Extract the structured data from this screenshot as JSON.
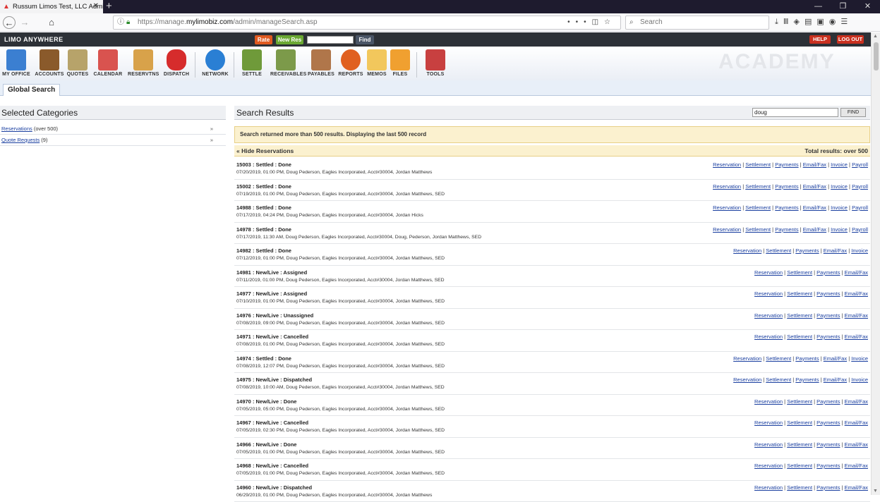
{
  "browser": {
    "tab_title": "Russum Limos Test, LLC Admin",
    "url_domain_prefix": "https://manage.",
    "url_domain": "mylimobiz.com",
    "url_path": "/admin/manageSearch.asp",
    "search_placeholder": "Search"
  },
  "app": {
    "logo": "LIMO ANYWHERE",
    "quick": {
      "rate": "Rate",
      "new_res": "New Res",
      "find": "Find"
    },
    "help": "HELP",
    "logout": "LOG OUT",
    "watermark": "ACADEMY",
    "toolbar": [
      {
        "label": "MY OFFICE",
        "icon": "office-building-icon",
        "color": "#3b7fd1"
      },
      {
        "label": "ACCOUNTS",
        "icon": "address-book-icon",
        "color": "#8a5a2b"
      },
      {
        "label": "QUOTES",
        "icon": "money-bag-icon",
        "color": "#b7a36a"
      },
      {
        "label": "CALENDAR",
        "icon": "calendar-icon",
        "color": "#d9534f"
      },
      {
        "label": "RESERVTNS",
        "icon": "clipboard-icon",
        "color": "#d8a24a"
      },
      {
        "label": "DISPATCH",
        "icon": "car-icon",
        "color": "#d62c2c"
      },
      {
        "label": "NETWORK",
        "icon": "globe-icon",
        "color": "#2a7fd4"
      },
      {
        "label": "SETTLE",
        "icon": "cash-icon",
        "color": "#6f9a3a"
      },
      {
        "label": "RECEIVABLES",
        "icon": "inbox-in-icon",
        "color": "#7c9a4a"
      },
      {
        "label": "PAYABLES",
        "icon": "inbox-out-icon",
        "color": "#b0764a"
      },
      {
        "label": "REPORTS",
        "icon": "pie-chart-icon",
        "color": "#e06020"
      },
      {
        "label": "MEMOS",
        "icon": "sticky-note-icon",
        "color": "#f2c75c"
      },
      {
        "label": "FILES",
        "icon": "folder-icon",
        "color": "#f0a030"
      },
      {
        "label": "TOOLS",
        "icon": "tools-icon",
        "color": "#c84040"
      }
    ],
    "subtab": "Global Search"
  },
  "left": {
    "title": "Selected Categories",
    "items": [
      {
        "label": "Reservations",
        "count": "(over 500)",
        "arrow": "»"
      },
      {
        "label": "Quote Requests",
        "count": "(9)",
        "arrow": "»"
      }
    ]
  },
  "main": {
    "title": "Search Results",
    "search_value": "doug",
    "find_label": "FIND",
    "warning": "Search returned more than 500 results. Displaying the last 500 record",
    "section_toggle": "« Hide Reservations",
    "total": "Total results: over 500",
    "rows": [
      {
        "title": "15003 : Settled : Done",
        "detail": "07/20/2019, 01:00 PM, Doug Pederson, Eagles Incorporated, Acct#30004, Jordan Matthews",
        "links": [
          "Reservation",
          "Settlement",
          "Payments",
          "Email/Fax",
          "Invoice",
          "Payroll"
        ]
      },
      {
        "title": "15002 : Settled : Done",
        "detail": "07/19/2019, 01:00 PM, Doug Pederson, Eagles Incorporated, Acct#30004, Jordan Matthews, SED",
        "links": [
          "Reservation",
          "Settlement",
          "Payments",
          "Email/Fax",
          "Invoice",
          "Payroll"
        ]
      },
      {
        "title": "14988 : Settled : Done",
        "detail": "07/17/2019, 04:24 PM, Doug Pederson, Eagles Incorporated, Acct#30004, Jordan Hicks",
        "links": [
          "Reservation",
          "Settlement",
          "Payments",
          "Email/Fax",
          "Invoice",
          "Payroll"
        ]
      },
      {
        "title": "14978 : Settled : Done",
        "detail": "07/17/2019, 11:30 AM, Doug Pederson, Eagles Incorporated, Acct#30004, Doug, Pederson, Jordan Matthews, SED",
        "links": [
          "Reservation",
          "Settlement",
          "Payments",
          "Email/Fax",
          "Invoice",
          "Payroll"
        ]
      },
      {
        "title": "14982 : Settled : Done",
        "detail": "07/12/2019, 01:00 PM, Doug Pederson, Eagles Incorporated, Acct#30004, Jordan Matthews, SED",
        "links": [
          "Reservation",
          "Settlement",
          "Payments",
          "Email/Fax",
          "Invoice"
        ]
      },
      {
        "title": "14981 : New/Live : Assigned",
        "detail": "07/11/2019, 01:00 PM, Doug Pederson, Eagles Incorporated, Acct#30004, Jordan Matthews, SED",
        "links": [
          "Reservation",
          "Settlement",
          "Payments",
          "Email/Fax"
        ]
      },
      {
        "title": "14977 : New/Live : Assigned",
        "detail": "07/10/2019, 01:00 PM, Doug Pederson, Eagles Incorporated, Acct#30004, Jordan Matthews, SED",
        "links": [
          "Reservation",
          "Settlement",
          "Payments",
          "Email/Fax"
        ]
      },
      {
        "title": "14976 : New/Live : Unassigned",
        "detail": "07/08/2019, 09:00 PM, Doug Pederson, Eagles Incorporated, Acct#30004, Jordan Matthews, SED",
        "links": [
          "Reservation",
          "Settlement",
          "Payments",
          "Email/Fax"
        ]
      },
      {
        "title": "14971 : New/Live : Cancelled",
        "detail": "07/08/2019, 01:00 PM, Doug Pederson, Eagles Incorporated, Acct#30004, Jordan Matthews, SED",
        "links": [
          "Reservation",
          "Settlement",
          "Payments",
          "Email/Fax"
        ]
      },
      {
        "title": "14974 : Settled : Done",
        "detail": "07/08/2019, 12:07 PM, Doug Pederson, Eagles Incorporated, Acct#30004, Jordan Matthews, SED",
        "links": [
          "Reservation",
          "Settlement",
          "Payments",
          "Email/Fax",
          "Invoice"
        ]
      },
      {
        "title": "14975 : New/Live : Dispatched",
        "detail": "07/08/2019, 10:00 AM, Doug Pederson, Eagles Incorporated, Acct#30004, Jordan Matthews, SED",
        "links": [
          "Reservation",
          "Settlement",
          "Payments",
          "Email/Fax",
          "Invoice"
        ]
      },
      {
        "title": "14970 : New/Live : Done",
        "detail": "07/05/2019, 05:00 PM, Doug Pederson, Eagles Incorporated, Acct#30004, Jordan Matthews, SED",
        "links": [
          "Reservation",
          "Settlement",
          "Payments",
          "Email/Fax"
        ]
      },
      {
        "title": "14967 : New/Live : Cancelled",
        "detail": "07/05/2019, 02:30 PM, Doug Pederson, Eagles Incorporated, Acct#30004, Jordan Matthews, SED",
        "links": [
          "Reservation",
          "Settlement",
          "Payments",
          "Email/Fax"
        ]
      },
      {
        "title": "14966 : New/Live : Done",
        "detail": "07/05/2019, 01:00 PM, Doug Pederson, Eagles Incorporated, Acct#30004, Jordan Matthews, SED",
        "links": [
          "Reservation",
          "Settlement",
          "Payments",
          "Email/Fax"
        ]
      },
      {
        "title": "14968 : New/Live : Cancelled",
        "detail": "07/05/2019, 01:00 PM, Doug Pederson, Eagles Incorporated, Acct#30004, Jordan Matthews, SED",
        "links": [
          "Reservation",
          "Settlement",
          "Payments",
          "Email/Fax"
        ]
      },
      {
        "title": "14960 : New/Live : Dispatched",
        "detail": "06/29/2019, 01:00 PM, Doug Pederson, Eagles Incorporated, Acct#30004, Jordan Matthews",
        "links": [
          "Reservation",
          "Settlement",
          "Payments",
          "Email/Fax"
        ]
      }
    ]
  }
}
